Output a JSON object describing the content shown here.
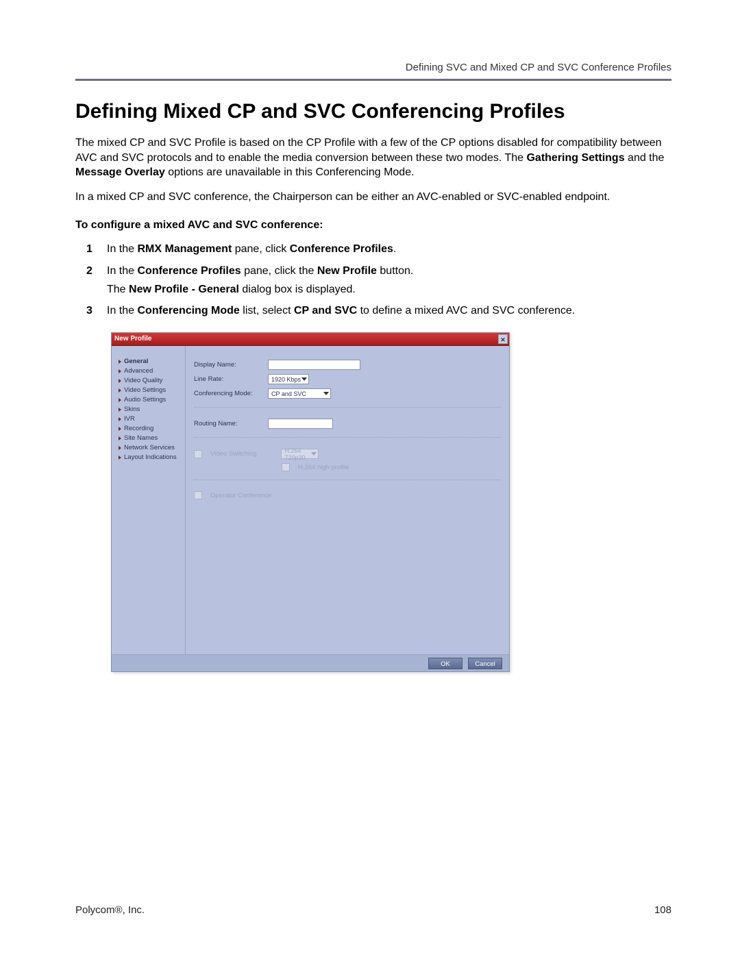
{
  "header": {
    "running_head": "Defining SVC and Mixed CP and SVC Conference Profiles"
  },
  "title": "Defining Mixed CP and SVC Conferencing Profiles",
  "paragraphs": {
    "p1_a": "The mixed CP and SVC Profile is based on the CP Profile with a few of the CP options disabled for compatibility between AVC and SVC protocols and to enable the media conversion between these two modes. The ",
    "p1_b1": "Gathering Settings",
    "p1_mid": " and the ",
    "p1_b2": "Message Overlay",
    "p1_c": " options are unavailable in this Conferencing Mode.",
    "p2": "In a mixed CP and SVC conference, the Chairperson can be either an AVC-enabled or SVC-enabled endpoint."
  },
  "subhead": "To configure a mixed AVC and SVC conference:",
  "steps": {
    "s1_a": "In the ",
    "s1_b1": "RMX Management",
    "s1_mid": " pane, click ",
    "s1_b2": "Conference Profiles",
    "s1_end": ".",
    "s2_a": "In the ",
    "s2_b1": "Conference Profiles",
    "s2_mid": " pane, click the ",
    "s2_b2": "New Profile",
    "s2_end": " button.",
    "s2_sub_a": "The ",
    "s2_sub_b": "New Profile - General",
    "s2_sub_end": " dialog box is displayed.",
    "s3_a": "In the ",
    "s3_b1": "Conferencing Mode",
    "s3_mid": " list, select ",
    "s3_b2": "CP and SVC",
    "s3_end": " to define a mixed AVC and SVC conference."
  },
  "dialog": {
    "title": "New Profile",
    "nav": [
      "General",
      "Advanced",
      "Video Quality",
      "Video Settings",
      "Audio Settings",
      "Skins",
      "IVR",
      "Recording",
      "Site Names",
      "Network Services",
      "Layout Indications"
    ],
    "labels": {
      "display_name": "Display Name:",
      "line_rate": "Line Rate:",
      "conf_mode": "Conferencing Mode:",
      "routing_name": "Routing Name:",
      "video_switch": "Video Switching",
      "h264_high": "H.264 high profile",
      "operator_conf": "Operator Conference"
    },
    "values": {
      "line_rate": "1920 Kbps",
      "conf_mode": "CP and SVC",
      "video_switch_sel": "H.264 720p30"
    },
    "buttons": {
      "ok": "OK",
      "cancel": "Cancel"
    }
  },
  "footer": {
    "left": "Polycom®, Inc.",
    "right": "108"
  }
}
